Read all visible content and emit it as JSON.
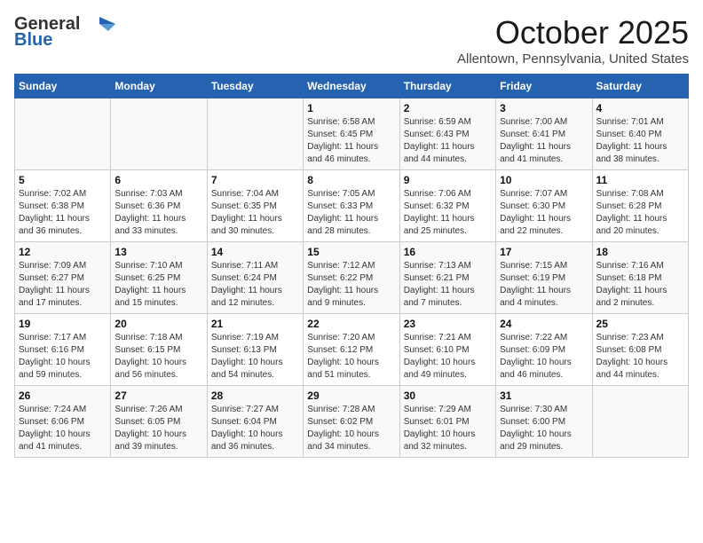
{
  "logo": {
    "line1": "General",
    "line2": "Blue"
  },
  "title": "October 2025",
  "subtitle": "Allentown, Pennsylvania, United States",
  "days_of_week": [
    "Sunday",
    "Monday",
    "Tuesday",
    "Wednesday",
    "Thursday",
    "Friday",
    "Saturday"
  ],
  "weeks": [
    [
      {
        "day": "",
        "info": ""
      },
      {
        "day": "",
        "info": ""
      },
      {
        "day": "",
        "info": ""
      },
      {
        "day": "1",
        "info": "Sunrise: 6:58 AM\nSunset: 6:45 PM\nDaylight: 11 hours\nand 46 minutes."
      },
      {
        "day": "2",
        "info": "Sunrise: 6:59 AM\nSunset: 6:43 PM\nDaylight: 11 hours\nand 44 minutes."
      },
      {
        "day": "3",
        "info": "Sunrise: 7:00 AM\nSunset: 6:41 PM\nDaylight: 11 hours\nand 41 minutes."
      },
      {
        "day": "4",
        "info": "Sunrise: 7:01 AM\nSunset: 6:40 PM\nDaylight: 11 hours\nand 38 minutes."
      }
    ],
    [
      {
        "day": "5",
        "info": "Sunrise: 7:02 AM\nSunset: 6:38 PM\nDaylight: 11 hours\nand 36 minutes."
      },
      {
        "day": "6",
        "info": "Sunrise: 7:03 AM\nSunset: 6:36 PM\nDaylight: 11 hours\nand 33 minutes."
      },
      {
        "day": "7",
        "info": "Sunrise: 7:04 AM\nSunset: 6:35 PM\nDaylight: 11 hours\nand 30 minutes."
      },
      {
        "day": "8",
        "info": "Sunrise: 7:05 AM\nSunset: 6:33 PM\nDaylight: 11 hours\nand 28 minutes."
      },
      {
        "day": "9",
        "info": "Sunrise: 7:06 AM\nSunset: 6:32 PM\nDaylight: 11 hours\nand 25 minutes."
      },
      {
        "day": "10",
        "info": "Sunrise: 7:07 AM\nSunset: 6:30 PM\nDaylight: 11 hours\nand 22 minutes."
      },
      {
        "day": "11",
        "info": "Sunrise: 7:08 AM\nSunset: 6:28 PM\nDaylight: 11 hours\nand 20 minutes."
      }
    ],
    [
      {
        "day": "12",
        "info": "Sunrise: 7:09 AM\nSunset: 6:27 PM\nDaylight: 11 hours\nand 17 minutes."
      },
      {
        "day": "13",
        "info": "Sunrise: 7:10 AM\nSunset: 6:25 PM\nDaylight: 11 hours\nand 15 minutes."
      },
      {
        "day": "14",
        "info": "Sunrise: 7:11 AM\nSunset: 6:24 PM\nDaylight: 11 hours\nand 12 minutes."
      },
      {
        "day": "15",
        "info": "Sunrise: 7:12 AM\nSunset: 6:22 PM\nDaylight: 11 hours\nand 9 minutes."
      },
      {
        "day": "16",
        "info": "Sunrise: 7:13 AM\nSunset: 6:21 PM\nDaylight: 11 hours\nand 7 minutes."
      },
      {
        "day": "17",
        "info": "Sunrise: 7:15 AM\nSunset: 6:19 PM\nDaylight: 11 hours\nand 4 minutes."
      },
      {
        "day": "18",
        "info": "Sunrise: 7:16 AM\nSunset: 6:18 PM\nDaylight: 11 hours\nand 2 minutes."
      }
    ],
    [
      {
        "day": "19",
        "info": "Sunrise: 7:17 AM\nSunset: 6:16 PM\nDaylight: 10 hours\nand 59 minutes."
      },
      {
        "day": "20",
        "info": "Sunrise: 7:18 AM\nSunset: 6:15 PM\nDaylight: 10 hours\nand 56 minutes."
      },
      {
        "day": "21",
        "info": "Sunrise: 7:19 AM\nSunset: 6:13 PM\nDaylight: 10 hours\nand 54 minutes."
      },
      {
        "day": "22",
        "info": "Sunrise: 7:20 AM\nSunset: 6:12 PM\nDaylight: 10 hours\nand 51 minutes."
      },
      {
        "day": "23",
        "info": "Sunrise: 7:21 AM\nSunset: 6:10 PM\nDaylight: 10 hours\nand 49 minutes."
      },
      {
        "day": "24",
        "info": "Sunrise: 7:22 AM\nSunset: 6:09 PM\nDaylight: 10 hours\nand 46 minutes."
      },
      {
        "day": "25",
        "info": "Sunrise: 7:23 AM\nSunset: 6:08 PM\nDaylight: 10 hours\nand 44 minutes."
      }
    ],
    [
      {
        "day": "26",
        "info": "Sunrise: 7:24 AM\nSunset: 6:06 PM\nDaylight: 10 hours\nand 41 minutes."
      },
      {
        "day": "27",
        "info": "Sunrise: 7:26 AM\nSunset: 6:05 PM\nDaylight: 10 hours\nand 39 minutes."
      },
      {
        "day": "28",
        "info": "Sunrise: 7:27 AM\nSunset: 6:04 PM\nDaylight: 10 hours\nand 36 minutes."
      },
      {
        "day": "29",
        "info": "Sunrise: 7:28 AM\nSunset: 6:02 PM\nDaylight: 10 hours\nand 34 minutes."
      },
      {
        "day": "30",
        "info": "Sunrise: 7:29 AM\nSunset: 6:01 PM\nDaylight: 10 hours\nand 32 minutes."
      },
      {
        "day": "31",
        "info": "Sunrise: 7:30 AM\nSunset: 6:00 PM\nDaylight: 10 hours\nand 29 minutes."
      },
      {
        "day": "",
        "info": ""
      }
    ]
  ]
}
